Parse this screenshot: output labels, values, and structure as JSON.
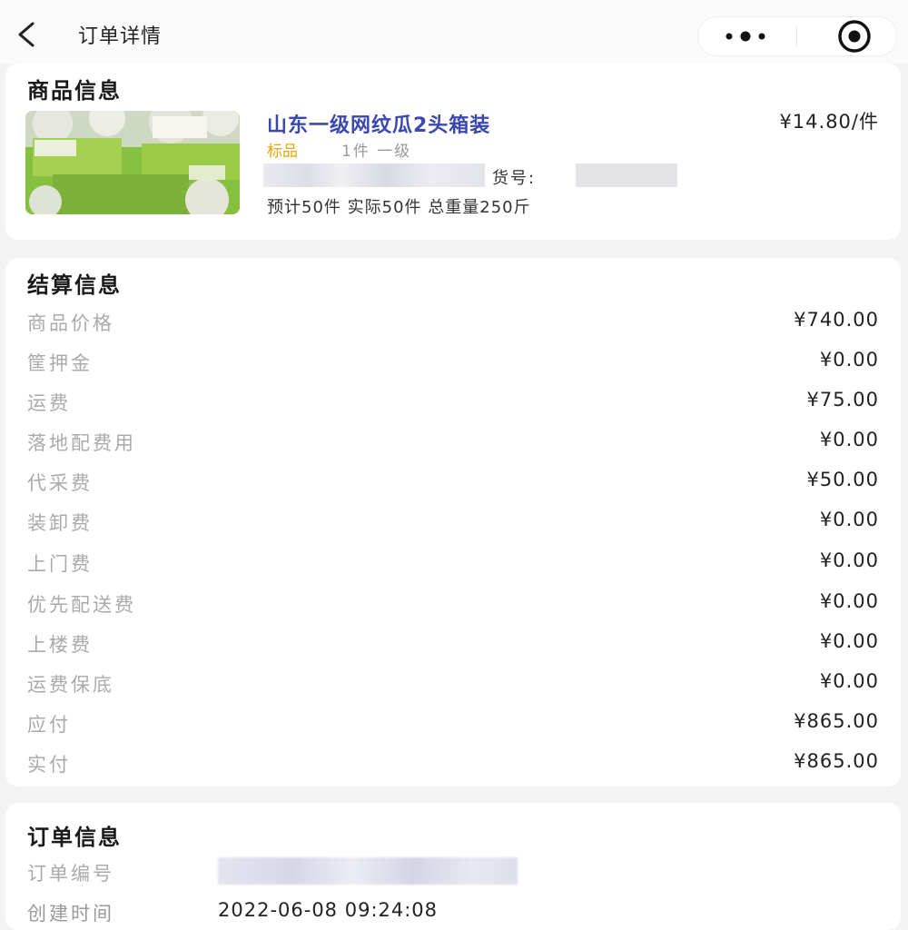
{
  "nav": {
    "title": "订单详情"
  },
  "product": {
    "section_title": "商品信息",
    "name": "山东一级网纹瓜2头箱装",
    "price": "¥14.80/件",
    "tag": "标品",
    "spec": "1件 一级",
    "item_no_label": "货号:",
    "stats": "预计50件 实际50件 总重量250斤"
  },
  "settlement": {
    "section_title": "结算信息",
    "rows": [
      {
        "label": "商品价格",
        "value": "¥740.00"
      },
      {
        "label": "筐押金",
        "value": "¥0.00"
      },
      {
        "label": "运费",
        "value": "¥75.00"
      },
      {
        "label": "落地配费用",
        "value": "¥0.00"
      },
      {
        "label": "代采费",
        "value": "¥50.00"
      },
      {
        "label": "装卸费",
        "value": "¥0.00"
      },
      {
        "label": "上门费",
        "value": "¥0.00"
      },
      {
        "label": "优先配送费",
        "value": "¥0.00"
      },
      {
        "label": "上楼费",
        "value": "¥0.00"
      },
      {
        "label": "运费保底",
        "value": "¥0.00"
      },
      {
        "label": "应付",
        "value": "¥865.00"
      },
      {
        "label": "实付",
        "value": "¥865.00"
      }
    ]
  },
  "order": {
    "section_title": "订单信息",
    "number_label": "订单编号",
    "created_label": "创建时间",
    "created_value": "2022-06-08 09:24:08"
  },
  "icons": {
    "back": "chevron-left-icon",
    "more": "more-dots-icon",
    "close": "target-circle-icon"
  },
  "colors": {
    "product_name": "#3a48b0",
    "tag": "#e5a50a",
    "label": "#aaaaaa"
  }
}
